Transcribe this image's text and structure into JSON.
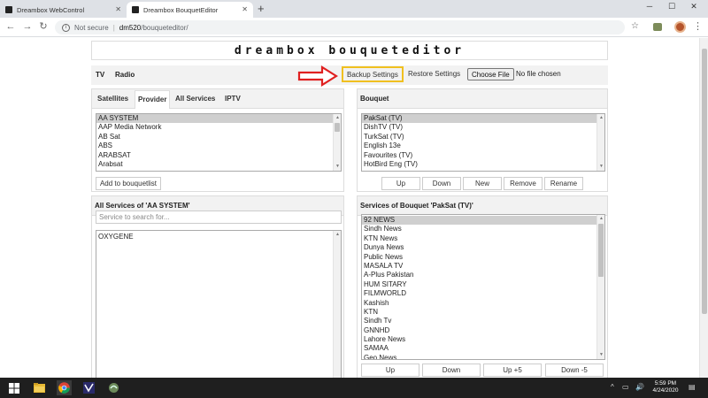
{
  "browser": {
    "tabs": [
      {
        "title": "Dreambox WebControl"
      },
      {
        "title": "Dreambox BouquetEditor"
      }
    ],
    "address": {
      "security": "Not secure",
      "host": "dm520",
      "path": "/bouqueteditor/"
    }
  },
  "page": {
    "banner": "dreambox bouqueteditor",
    "top_tabs": [
      "TV",
      "Radio"
    ],
    "backup_label": "Backup Settings",
    "restore_label": "Restore Settings",
    "choose_file_label": "Choose File",
    "no_file_label": "No file chosen",
    "highlight_color": "#f0c020",
    "arrow_color": "#e02020"
  },
  "left_panel": {
    "tabs": [
      "Satellites",
      "Provider",
      "All Services",
      "IPTV"
    ],
    "active_tab": "Provider",
    "providers": [
      "AA SYSTEM",
      "AAP Media Network",
      "AB Sat",
      "ABS",
      "ARABSAT",
      "Arabsat"
    ],
    "selected_provider": "AA SYSTEM",
    "add_button": "Add to bouquetlist"
  },
  "left_services": {
    "title": "All Services of 'AA SYSTEM'",
    "search_placeholder": "Service to search for...",
    "items": [
      "OXYGENE"
    ]
  },
  "right_panel": {
    "title": "Bouquet",
    "bouquets": [
      "PakSat (TV)",
      "DishTV (TV)",
      "TurkSat (TV)",
      "English 13e",
      "Favourites (TV)",
      "HotBird Eng (TV)"
    ],
    "selected": "PakSat (TV)",
    "buttons": [
      "Up",
      "Down",
      "New",
      "Remove",
      "Rename"
    ]
  },
  "right_services": {
    "title": "Services of Bouquet 'PakSat (TV)'",
    "items": [
      "92 NEWS",
      "Sindh News",
      "KTN News",
      "Dunya News",
      "Public News",
      "MASALA TV",
      "A-Plus Pakistan",
      "HUM SITARY",
      "FILMWORLD",
      "Kashish",
      "KTN",
      "Sindh Tv",
      "GNNHD",
      "Lahore News",
      "SAMAA",
      "Geo News"
    ],
    "selected": "92 NEWS",
    "buttons": [
      "Up",
      "Down",
      "Up +5",
      "Down -5"
    ]
  },
  "taskbar": {
    "time": "5:59 PM",
    "date": "4/24/2020"
  }
}
